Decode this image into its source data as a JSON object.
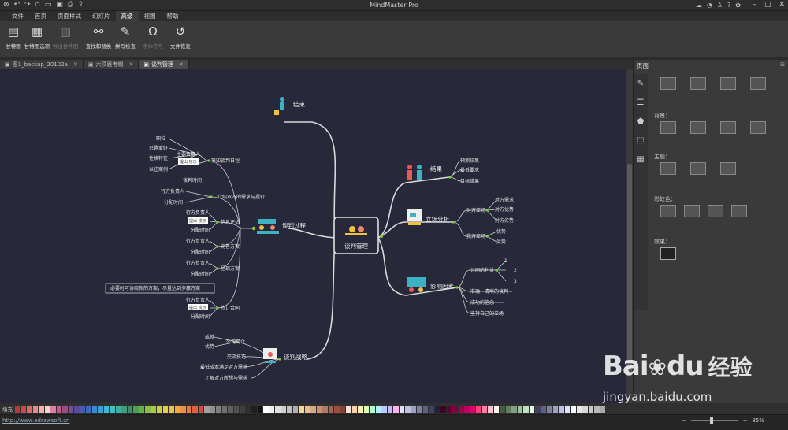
{
  "window": {
    "title": "MindMaster Pro"
  },
  "menu": {
    "items": [
      "文件",
      "首页",
      "页面样式",
      "幻灯片",
      "高级",
      "视图",
      "帮助"
    ],
    "active_index": 4
  },
  "ribbon": {
    "buttons": [
      {
        "label": "甘特图",
        "icon": "gantt-icon",
        "disabled": false
      },
      {
        "label": "甘特图选项",
        "icon": "gantt-options-icon",
        "disabled": false
      },
      {
        "label": "导出甘特图",
        "icon": "export-gantt-icon",
        "disabled": true
      },
      {
        "label": "查找和替换",
        "icon": "binoculars-icon",
        "disabled": false
      },
      {
        "label": "拼写检查",
        "icon": "spellcheck-icon",
        "disabled": false
      },
      {
        "label": "字体符号",
        "icon": "omega-icon",
        "disabled": true
      },
      {
        "label": "文件恢复",
        "icon": "history-icon",
        "disabled": false
      }
    ]
  },
  "tabs": [
    {
      "label": "图1_backup_20102a",
      "active": false
    },
    {
      "label": "六顶思考帽",
      "active": false
    },
    {
      "label": "谈判管理",
      "active": true
    }
  ],
  "panel": {
    "title": "页面",
    "sections": {
      "background": "背景：",
      "theme": "主题：",
      "rainbow": "彩虹色：",
      "effect": "效果："
    }
  },
  "mindmap": {
    "central": "谈判管理",
    "branches": {
      "end": "结束",
      "process": "谈判过程",
      "strategy": "谈判战略",
      "result": "结果",
      "position": "立场分析",
      "factors": "影响因素"
    },
    "labels": {
      "familiarize": "熟知谈判日程",
      "lead": "主要负责人",
      "rank": "职位",
      "interest": "兴趣爱好",
      "traits": "性格特征",
      "cases": "以往案例",
      "note1": "提出 攻示",
      "negotiate_time": "谈判时间",
      "introduce": "介绍双方的需求与提价",
      "owner1": "行方负责人",
      "split_time1": "分配时间",
      "info_eval": "信息评估",
      "owner2": "行方负责人",
      "note2": "提出 攻示",
      "split_time2": "分配时间",
      "refine": "完善方案",
      "owner3": "行方负责人",
      "split_time3": "分配时间",
      "present": "呈现方案",
      "owner4": "行方负责人",
      "split_time4": "分配时间",
      "callout": "必要时可协商新的方案，尽量达到多赢方案",
      "sign": "签订合同",
      "owner5": "行方负责人",
      "note3": "提出 攻示",
      "split_time5": "分配时间",
      "company": "公司简介",
      "achievement": "成就",
      "advantage": "优势",
      "skills": "交流技巧",
      "min_cost": "最低成本满足对方需求",
      "understand": "了解对方所想与需求",
      "prepare_result": "预测结果",
      "best_result": "最低要求",
      "final_result": "目标结果",
      "our_position": "对方立场",
      "their_needs": "对方需求",
      "their_strength": "对方优势",
      "their_weakness": "对方劣势",
      "my_position": "我方立场",
      "strength": "优势",
      "weakness": "劣势",
      "common_interest": "共同的利益",
      "n1": "1",
      "n2": "2",
      "n3": "3",
      "accurate": "准确，清晰的谈判",
      "success": "成功的信念",
      "stand_firm": "坚持自己的立场"
    }
  },
  "colors": {
    "canvas": "#27293a",
    "branch": "#d9d9d9",
    "node_dot": "#7ccf3e",
    "accent": "#f2c040"
  },
  "statusbar": {
    "url": "http://www.edrawsoft.cn",
    "zoom": "85%"
  },
  "colorbar": {
    "label": "填充"
  },
  "watermark": {
    "brand_a": "Bai",
    "brand_b": "du",
    "brand_c": "经验",
    "sub": "jingyan.baidu.com"
  }
}
